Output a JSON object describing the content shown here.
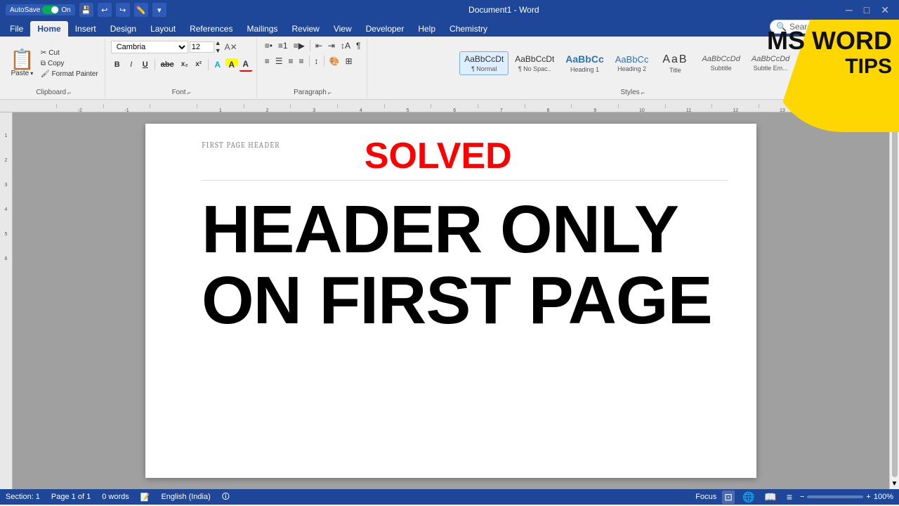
{
  "titlebar": {
    "autosave_label": "AutoSave",
    "autosave_state": "On",
    "title": "Document1 - Word",
    "undo_icon": "↩",
    "redo_icon": "↪",
    "close_icon": "✕"
  },
  "tabs": {
    "items": [
      "File",
      "Home",
      "Insert",
      "Design",
      "Layout",
      "References",
      "Mailings",
      "Review",
      "View",
      "Developer",
      "Help",
      "Chemistry"
    ],
    "active": "Home"
  },
  "ribbon": {
    "clipboard": {
      "label": "Clipboard",
      "paste_label": "Paste",
      "cut_label": "Cut",
      "copy_label": "Copy",
      "format_painter_label": "Format Painter"
    },
    "font": {
      "label": "Font",
      "font_name": "Cambria",
      "font_size": "12",
      "bold": "B",
      "italic": "I",
      "underline": "U",
      "strikethrough": "abc",
      "subscript": "x₂",
      "superscript": "x²"
    },
    "paragraph": {
      "label": "Paragraph"
    },
    "styles": {
      "label": "Styles",
      "items": [
        {
          "preview": "AaBbCcDt",
          "label": "¶ Normal",
          "active": true
        },
        {
          "preview": "AaBbCcDt",
          "label": "¶ No Spac.."
        },
        {
          "preview": "AaBbCc",
          "label": "Heading 1"
        },
        {
          "preview": "AaBbCc",
          "label": "Heading 2"
        },
        {
          "preview": "AaB",
          "label": "Title"
        },
        {
          "preview": "AaBbCcDd",
          "label": "Subtitle"
        },
        {
          "preview": "AaBbCcDd",
          "label": "Subtle Em..."
        }
      ]
    },
    "search": {
      "placeholder": "Search",
      "icon": "🔍"
    }
  },
  "document": {
    "header": "FIRST PAGE HEADER",
    "solved": "SOLVED",
    "line1": "HEADER ONLY",
    "line2": "ON FIRST PAGE"
  },
  "statusbar": {
    "section": "Section: 1",
    "page": "Page 1 of 1",
    "words": "0 words",
    "language": "English (India)",
    "focus_label": "Focus",
    "zoom": "100%"
  },
  "brand": {
    "line1": "MS WORD",
    "line2": "TIPS"
  }
}
